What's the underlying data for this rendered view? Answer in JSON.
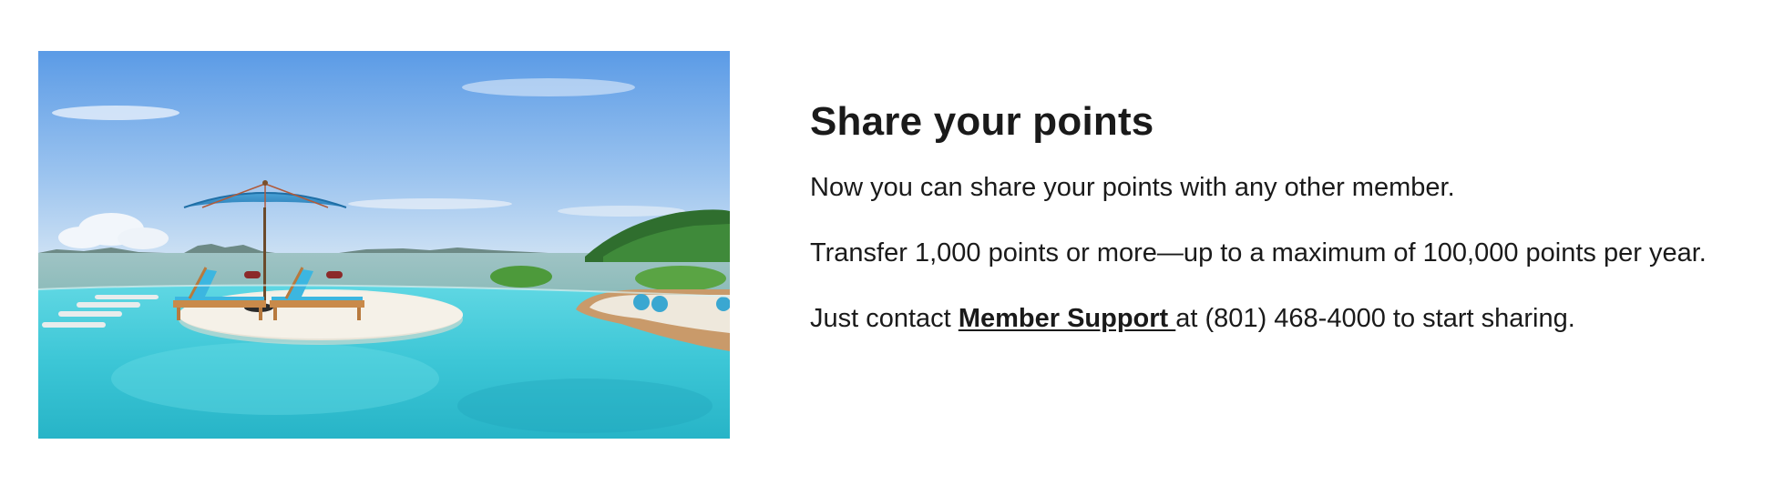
{
  "image": {
    "subject": "infinity pool with sun loungers and blue umbrella overlooking the sea"
  },
  "section": {
    "title": "Share your points",
    "paragraph_1": "Now you can share your points with any other member.",
    "paragraph_2": "Transfer 1,000 points or more—up to a maximum of 100,000 points per year.",
    "paragraph_3_before": "Just contact ",
    "support_link_label": "Member Support ",
    "paragraph_3_after": "at (801) 468-4000 to start sharing."
  },
  "colors": {
    "text": "#1a1a1a",
    "background": "#ffffff"
  }
}
